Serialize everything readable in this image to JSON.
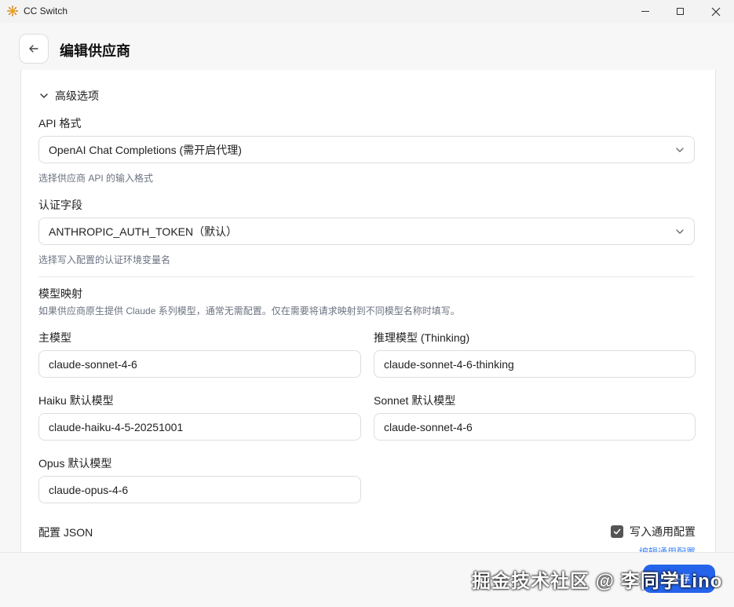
{
  "window": {
    "title": "CC Switch"
  },
  "header": {
    "title": "编辑供应商"
  },
  "advanced": {
    "toggle_label": "高级选项"
  },
  "api_format": {
    "label": "API 格式",
    "value": "OpenAI Chat Completions (需开启代理)",
    "hint": "选择供应商 API 的输入格式"
  },
  "auth_field": {
    "label": "认证字段",
    "value": "ANTHROPIC_AUTH_TOKEN（默认）",
    "hint": "选择写入配置的认证环境变量名"
  },
  "model_mapping": {
    "title": "模型映射",
    "hint": "如果供应商原生提供 Claude 系列模型，通常无需配置。仅在需要将请求映射到不同模型名称时填写。",
    "main_model": {
      "label": "主模型",
      "value": "claude-sonnet-4-6"
    },
    "thinking_model": {
      "label": "推理模型 (Thinking)",
      "value": "claude-sonnet-4-6-thinking"
    },
    "haiku_model": {
      "label": "Haiku 默认模型",
      "value": "claude-haiku-4-5-20251001"
    },
    "sonnet_model": {
      "label": "Sonnet 默认模型",
      "value": "claude-sonnet-4-6"
    },
    "opus_model": {
      "label": "Opus 默认模型",
      "value": "claude-opus-4-6"
    }
  },
  "config_json": {
    "label": "配置 JSON",
    "write_common_label": "写入通用配置",
    "write_common_checked": true,
    "edit_common_link": "编辑通用配置"
  },
  "footer": {
    "save_label": "保存"
  },
  "watermark": "掘金技术社区 @ 李同学Lino"
}
